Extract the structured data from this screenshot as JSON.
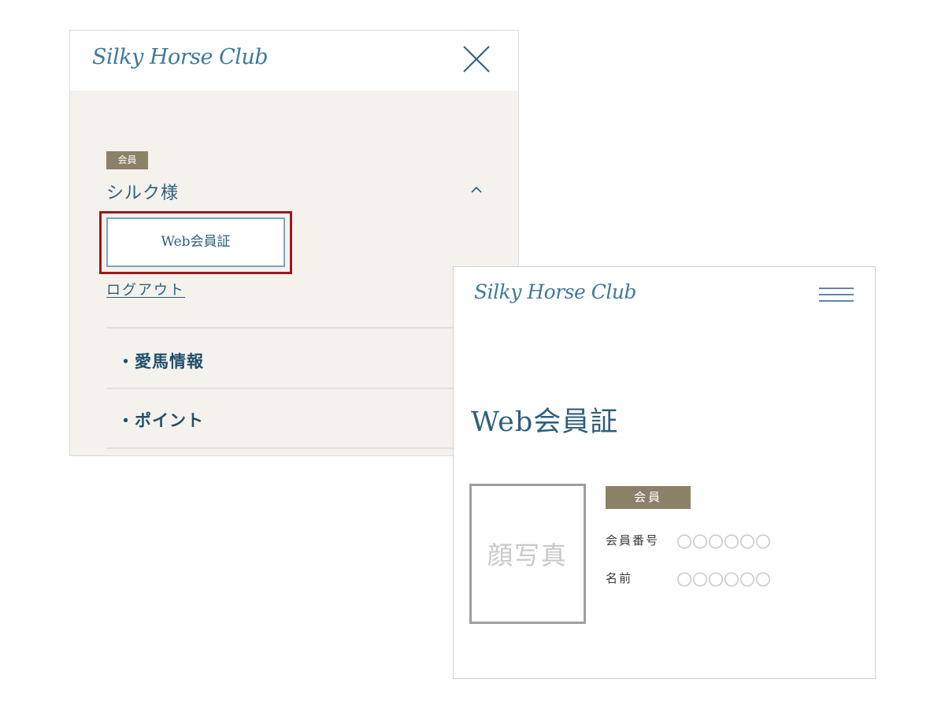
{
  "menu_screen": {
    "logo_text": "Silky Horse Club",
    "member_badge": "会員",
    "user_name": "シルク様",
    "webcard_button_label": "Web会員証",
    "logout_label": "ログアウト",
    "menu_items": [
      {
        "label": "・愛馬情報"
      },
      {
        "label": "・ポイント"
      }
    ]
  },
  "card_screen": {
    "logo_text": "Silky Horse Club",
    "page_title": "Web会員証",
    "photo_placeholder": "顔写真",
    "member_badge": "会員",
    "fields": [
      {
        "label": "会員番号",
        "value": "〇〇〇〇〇〇"
      },
      {
        "label": "名前",
        "value": "〇〇〇〇〇〇"
      }
    ]
  },
  "colors": {
    "brand_blue": "#2e5f7c",
    "badge_bg": "#8a8167",
    "menu_bg": "#f5f2ee",
    "highlight_red": "#a4141b"
  }
}
